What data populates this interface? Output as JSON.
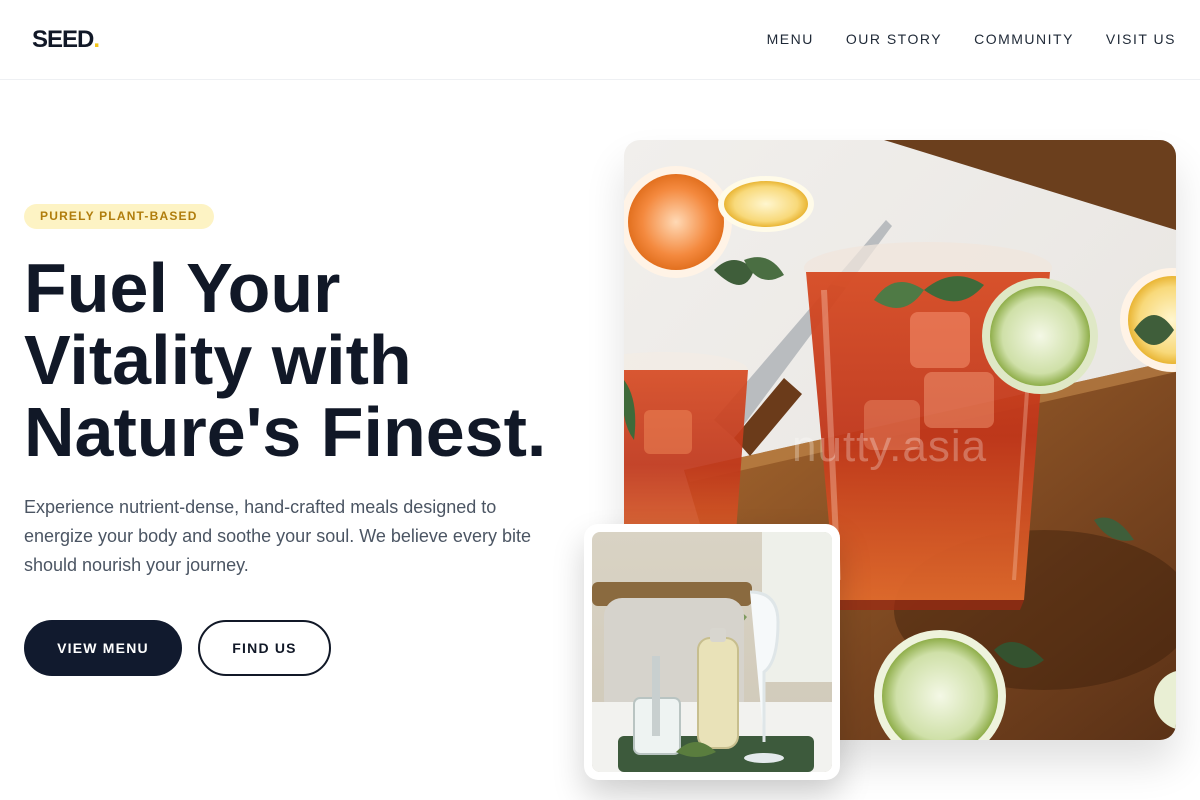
{
  "brand": {
    "name": "SEED",
    "dot": "."
  },
  "nav": {
    "items": [
      "MENU",
      "OUR STORY",
      "COMMUNITY",
      "VISIT US"
    ]
  },
  "hero": {
    "badge": "PURELY PLANT-BASED",
    "headline_line1": "Fuel Your",
    "headline_line2": "Vitality with",
    "headline_line3": "Nature's Finest.",
    "subtext": "Experience nutrient-dense, hand-crafted meals designed to energize your body and soothe your soul. We believe every bite should nourish your journey.",
    "primary_cta": "VIEW MENU",
    "secondary_cta": "FIND US"
  },
  "media": {
    "main_photo_watermark": "nutty.asia"
  },
  "colors": {
    "text_dark": "#111827",
    "accent_yellow": "#f5c518",
    "badge_bg": "#fdf3c4",
    "badge_text": "#b07d0c",
    "button_dark": "#111a2e",
    "body_gray": "#4b5563"
  }
}
